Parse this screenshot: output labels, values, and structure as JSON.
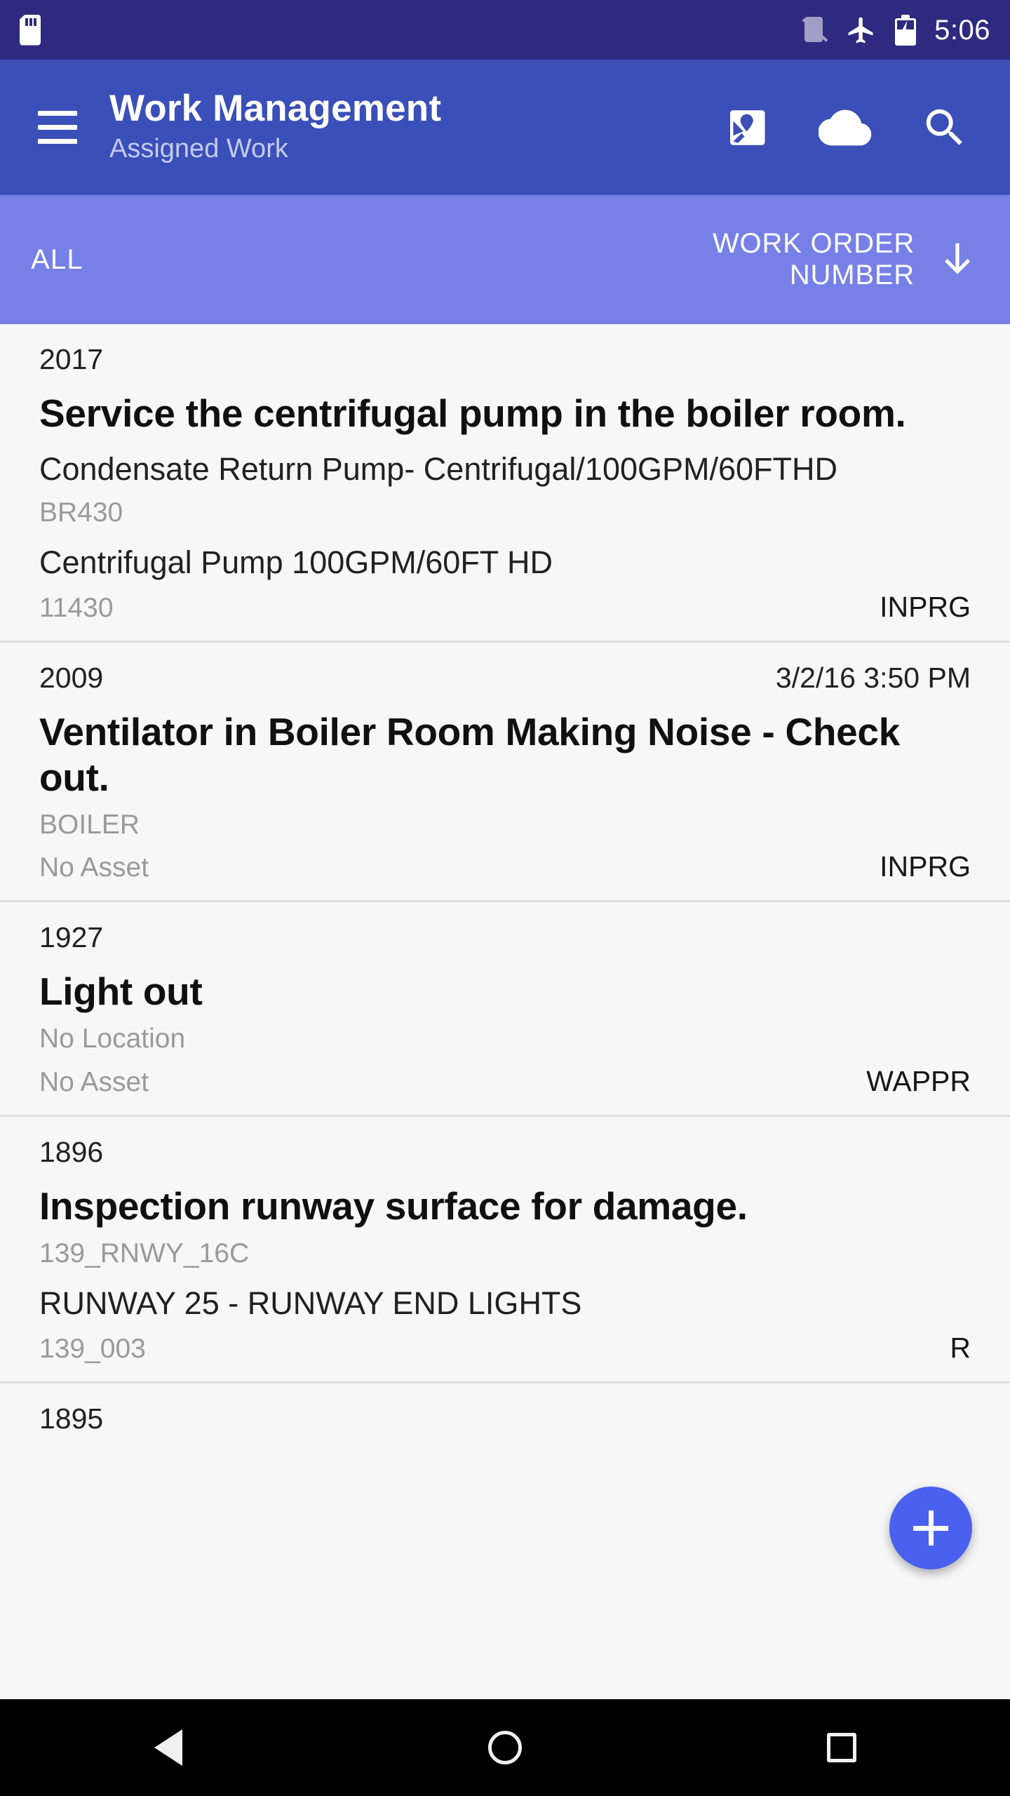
{
  "statusbar": {
    "time": "5:06",
    "icons": [
      "sdcard-icon",
      "no-signal-icon",
      "airplane-mode-icon",
      "battery-charging-icon"
    ]
  },
  "appbar": {
    "menu_icon": "hamburger-menu-icon",
    "title": "Work Management",
    "subtitle": "Assigned Work",
    "actions": [
      {
        "name": "map-pin-icon"
      },
      {
        "name": "cloud-icon"
      },
      {
        "name": "search-icon"
      }
    ]
  },
  "filterbar": {
    "filter_label": "ALL",
    "sort_label": "WORK ORDER NUMBER",
    "sort_direction_icon": "arrow-down-icon"
  },
  "work_orders": [
    {
      "number": "2017",
      "date": "",
      "description": "Service the centrifugal pump in the boiler room.",
      "location_description": "Condensate Return Pump- Centrifugal/100GPM/60FTHD",
      "location": "BR430",
      "asset_description": "Centrifugal Pump 100GPM/60FT HD",
      "asset": "11430",
      "status": "INPRG"
    },
    {
      "number": "2009",
      "date": "3/2/16 3:50 PM",
      "description": "Ventilator in Boiler Room Making Noise - Check out.",
      "location_description": "",
      "location": "BOILER",
      "asset_description": "",
      "asset": "No Asset",
      "status": "INPRG"
    },
    {
      "number": "1927",
      "date": "",
      "description": "Light out",
      "location_description": "",
      "location": "No Location",
      "asset_description": "",
      "asset": "No Asset",
      "status": "WAPPR"
    },
    {
      "number": "1896",
      "date": "",
      "description": "Inspection runway surface for damage.",
      "location_description": "",
      "location": "139_RNWY_16C",
      "asset_description": "RUNWAY 25 - RUNWAY END LIGHTS",
      "asset": "139_003",
      "status": "R"
    },
    {
      "number": "1895",
      "date": "",
      "description": "",
      "location_description": "",
      "location": "",
      "asset_description": "",
      "asset": "",
      "status": ""
    }
  ],
  "fab": {
    "icon": "plus-icon",
    "label": "+"
  },
  "navbar": {
    "back": "back-triangle-icon",
    "home": "home-circle-icon",
    "recents": "recents-square-icon"
  },
  "colors": {
    "statusbar_bg": "#2e2a7f",
    "appbar_bg": "#3b4fb8",
    "filterbar_bg": "#7680e6",
    "list_bg": "#f7f7f7",
    "fab_bg": "#4a60ef",
    "navbar_bg": "#000000",
    "muted_text": "#9a9a9a"
  }
}
